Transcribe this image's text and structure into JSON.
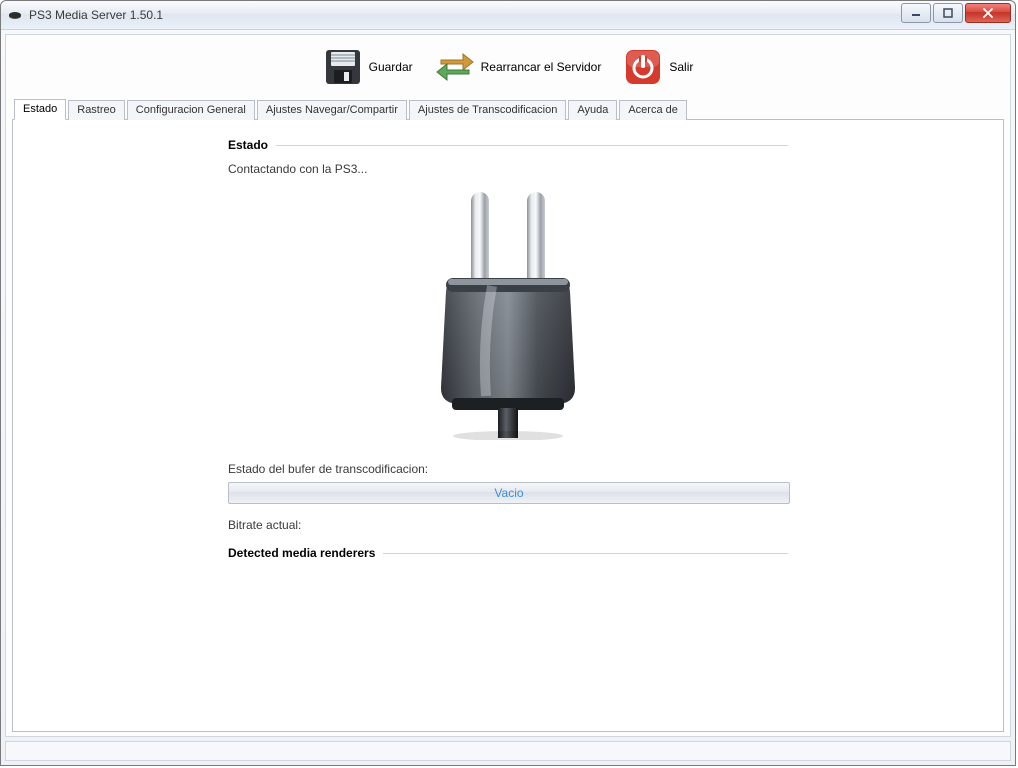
{
  "window": {
    "title": "PS3 Media Server 1.50.1"
  },
  "toolbar": {
    "save_label": "Guardar",
    "restart_label": "Rearrancar el Servidor",
    "exit_label": "Salir"
  },
  "tabs": [
    {
      "label": "Estado",
      "active": true
    },
    {
      "label": "Rastreo",
      "active": false
    },
    {
      "label": "Configuracion General",
      "active": false
    },
    {
      "label": "Ajustes Navegar/Compartir",
      "active": false
    },
    {
      "label": "Ajustes de Transcodificacion",
      "active": false
    },
    {
      "label": "Ayuda",
      "active": false
    },
    {
      "label": "Acerca de",
      "active": false
    }
  ],
  "status_panel": {
    "section_title": "Estado",
    "connecting_text": "Contactando con la PS3...",
    "buffer_label": "Estado del bufer de transcodificacion:",
    "buffer_value": "Vacio",
    "bitrate_label": "Bitrate actual:",
    "renderers_title": "Detected media renderers"
  }
}
